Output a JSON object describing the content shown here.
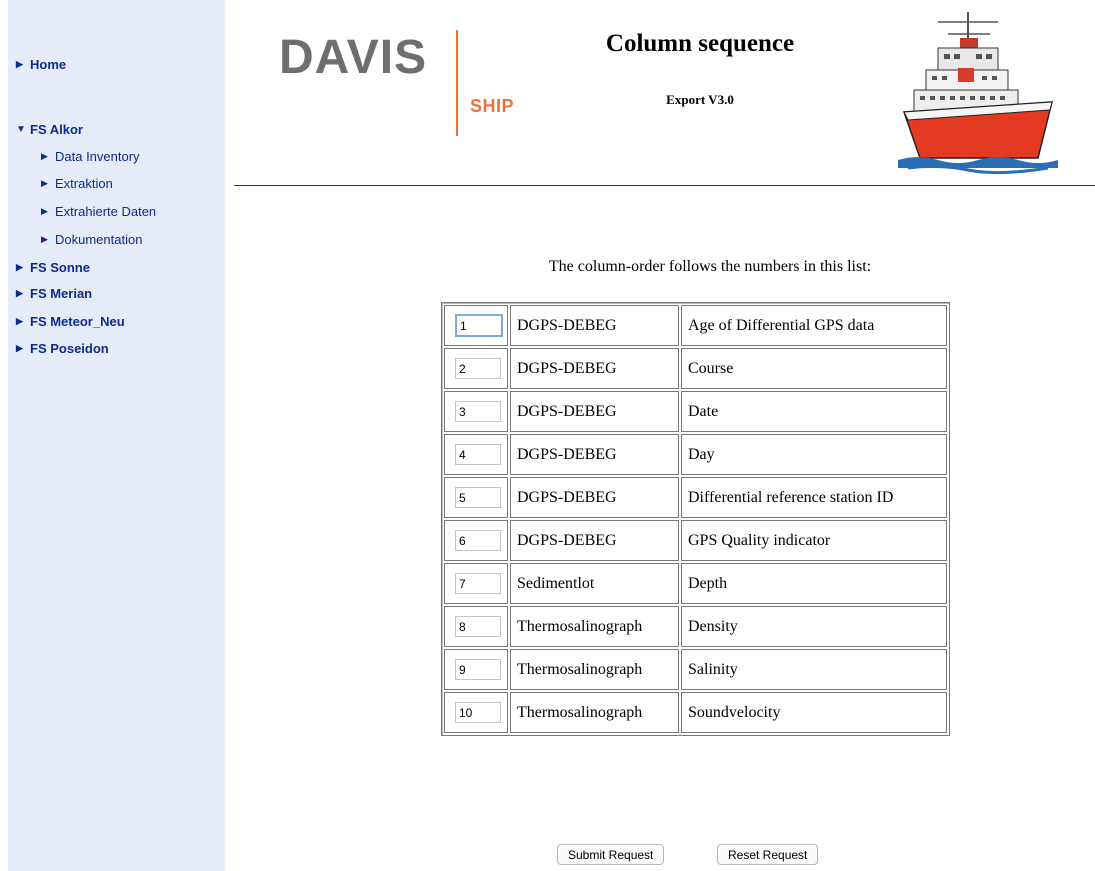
{
  "sidebar": {
    "home": "Home",
    "expanded_group": "FS Alkor",
    "sub_items": [
      "Data Inventory",
      "Extraktion",
      "Extrahierte Daten",
      "Dokumentation"
    ],
    "groups": [
      "FS Sonne",
      "FS Merian",
      "FS Meteor_Neu",
      "FS Poseidon"
    ]
  },
  "header": {
    "logo_main": "DAVIS",
    "logo_sub": "SHIP",
    "title": "Column sequence",
    "subtitle": "Export V3.0"
  },
  "main": {
    "intro": "The column-order follows the numbers in this list:",
    "rows": [
      {
        "order": "1",
        "source": "DGPS-DEBEG",
        "parameter": "Age of Differential GPS data"
      },
      {
        "order": "2",
        "source": "DGPS-DEBEG",
        "parameter": "Course"
      },
      {
        "order": "3",
        "source": "DGPS-DEBEG",
        "parameter": "Date"
      },
      {
        "order": "4",
        "source": "DGPS-DEBEG",
        "parameter": "Day"
      },
      {
        "order": "5",
        "source": "DGPS-DEBEG",
        "parameter": "Differential reference station ID"
      },
      {
        "order": "6",
        "source": "DGPS-DEBEG",
        "parameter": "GPS Quality indicator"
      },
      {
        "order": "7",
        "source": "Sedimentlot",
        "parameter": "Depth"
      },
      {
        "order": "8",
        "source": "Thermosalinograph",
        "parameter": "Density"
      },
      {
        "order": "9",
        "source": "Thermosalinograph",
        "parameter": "Salinity"
      },
      {
        "order": "10",
        "source": "Thermosalinograph",
        "parameter": "Soundvelocity"
      }
    ],
    "submit_label": "Submit Request",
    "reset_label": "Reset Request"
  },
  "colors": {
    "sidebar_bg": "#e5ecf8",
    "nav_text": "#0d2b8a",
    "logo_accent": "#e8743b",
    "logo_gray": "#6e6e6e"
  },
  "icons": {
    "collapsed": "triangle-right-icon",
    "expanded": "triangle-down-icon"
  }
}
